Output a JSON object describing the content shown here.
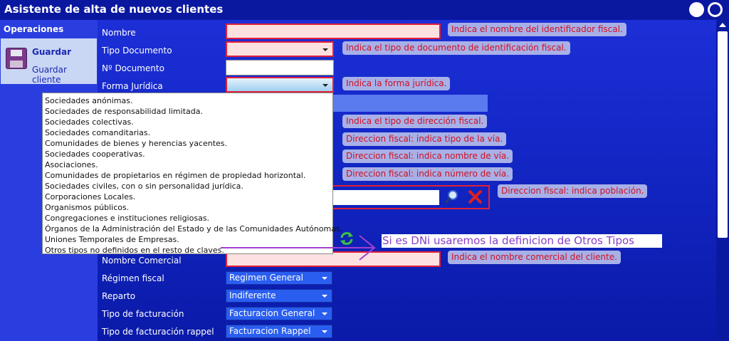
{
  "window": {
    "title": "Asistente de alta de nuevos clientes"
  },
  "sidebar": {
    "section": "Operaciones",
    "save_label": "Guardar",
    "save_sub": "Guardar cliente"
  },
  "form": {
    "nombre_label": "Nombre",
    "tipo_doc_label": "Tipo Documento",
    "num_doc_label": "Nº Documento",
    "forma_juridica_label": "Forma Jurídica",
    "nombre_comercial_label": "Nombre Comercial",
    "regimen_label": "Régimen fiscal",
    "regimen_value": "Regimen General",
    "reparto_label": "Reparto",
    "reparto_value": "Indiferente",
    "tipo_fact_label": "Tipo de facturación",
    "tipo_fact_value": "Facturacion General",
    "tipo_fact_rappel_label": "Tipo de facturación rappel",
    "tipo_fact_rappel_value": "Facturacion Rappel"
  },
  "tips": {
    "nombre": "Indica el nombre del identificador fiscal.",
    "tipo_doc": "Indica el tipo de documento de identificación fiscal.",
    "forma": "Indica la forma jurídica.",
    "tipo_dir": "Indica el tipo de dirección fiscal.",
    "via_tipo": "Direccion fiscal: indica tipo de la vía.",
    "via_nombre": "Direccion fiscal: indica nombre de vía.",
    "via_num": "Direccion fiscal: indica número de vía.",
    "poblacion": "Direccion fiscal: indica población.",
    "comercial": "Indica el nombre comercial del cliente."
  },
  "dropdown_options": [
    "Sociedades anónimas.",
    "Sociedades de responsabilidad limitada.",
    "Sociedades colectivas.",
    "Sociedades comanditarias.",
    "Comunidades de bienes y herencias yacentes.",
    "Sociedades cooperativas.",
    "Asociaciones.",
    "Comunidades de propietarios en régimen de propiedad horizontal.",
    "Sociedades civiles, con o sin personalidad jurídica.",
    "Corporaciones Locales.",
    "Organismos públicos.",
    "Congregaciones e instituciones religiosas.",
    "Órganos de la Administración del Estado y de las Comunidades Autónomas.",
    "Uniones Temporales de Empresas.",
    "Otros tipos no definidos en el resto de claves."
  ],
  "annotation": "Si es DNi usaremos la definicion de Otros Tipos",
  "colors": {
    "accent": "#1428c8",
    "tip_text": "#d01020",
    "annotation": "#8a3cc8"
  },
  "icons": [
    "floppy-disk-icon",
    "magnifier-icon",
    "red-x-icon",
    "refresh-icon",
    "scroll-up-icon",
    "arrow-icon"
  ]
}
